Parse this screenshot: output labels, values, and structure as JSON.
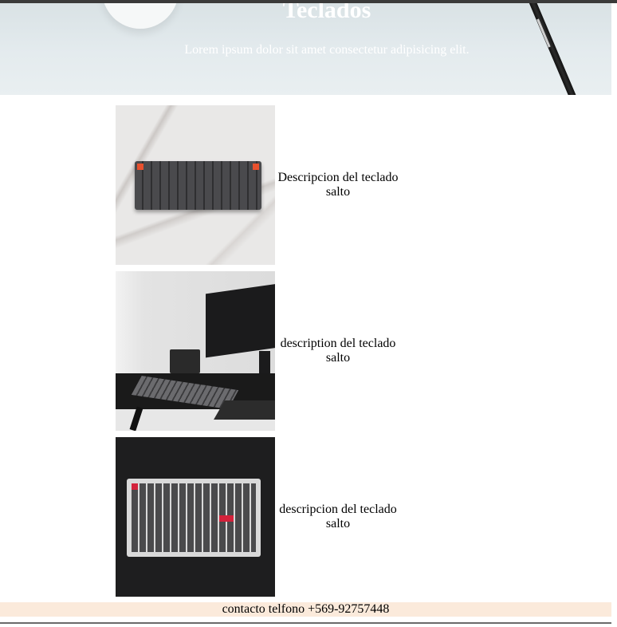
{
  "hero": {
    "title": "Teclados",
    "subtitle": "Lorem ipsum dolor sit amet consectetur adipisicing elit."
  },
  "products": [
    {
      "line1": "Descripcion del teclado",
      "line2": "salto"
    },
    {
      "line1": "description del teclado",
      "line2": "salto"
    },
    {
      "line1": "descripcion del teclado",
      "line2": "salto"
    }
  ],
  "footer": {
    "text": "contacto telfono +569-92757448"
  },
  "colors": {
    "footer_bg": "#fbeadb",
    "hero_bg": "#e4ebee"
  }
}
